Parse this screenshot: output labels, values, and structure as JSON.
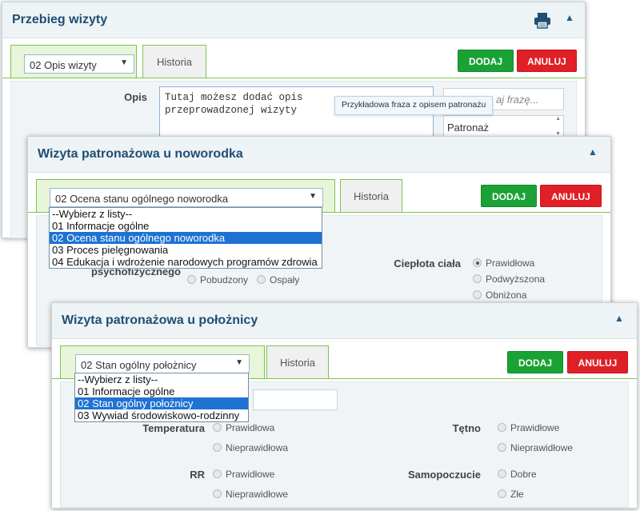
{
  "panel1": {
    "title": "Przebieg wizyty",
    "select_value": "02 Opis wizyty",
    "tab_history": "Historia",
    "btn_add": "DODAJ",
    "btn_cancel": "ANULUJ",
    "opis_label": "Opis",
    "textarea_value": "Tutaj możesz dodać opis\nprzeprowadzonej wizyty",
    "search_placeholder": "Wpisz frazę...",
    "search_visible": "aj frazę...",
    "tooltip": "Przykładowa fraza z opisem patronażu",
    "phrase_item": "Patronaż"
  },
  "panel2": {
    "title": "Wizyta patronażowa u noworodka",
    "select_value": "02 Ocena stanu ogólnego noworodka",
    "tab_history": "Historia",
    "btn_add": "DODAJ",
    "btn_cancel": "ANULUJ",
    "dropdown": [
      "--Wybierz z listy--",
      "01 Informacje ogólne",
      "02 Ocena stanu ogólnego noworodka",
      "03 Proces pielęgnowania",
      "04 Edukacja i wdrożenie narodowych programów zdrowia"
    ],
    "dropdown_selected_index": 2,
    "partial_label": "psychofizycznego",
    "radios_left": [
      "Pobudzony",
      "Ospały"
    ],
    "temp_label": "Ciepłota ciała",
    "temp_options": [
      "Prawidłowa",
      "Podwyższona",
      "Obniżona"
    ],
    "temp_checked_index": 0
  },
  "panel3": {
    "title": "Wizyta patronażowa u położnicy",
    "select_value": "02 Stan ogólny położnicy",
    "tab_history": "Historia",
    "btn_add": "DODAJ",
    "btn_cancel": "ANULUJ",
    "dropdown": [
      "--Wybierz z listy--",
      "01 Informacje ogólne",
      "02 Stan ogólny położnicy",
      "03 Wywiad środowiskowo-rodzinny"
    ],
    "dropdown_selected_index": 2,
    "temperatura_label": "Temperatura",
    "temperatura_options": [
      "Prawidłowa",
      "Nieprawidłowa"
    ],
    "tetno_label": "Tętno",
    "tetno_options": [
      "Prawidłowe",
      "Nieprawidłowe"
    ],
    "rr_label": "RR",
    "rr_options": [
      "Prawidłowe",
      "Nieprawidłowe"
    ],
    "samopoczucie_label": "Samopoczucie",
    "samopoczucie_options": [
      "Dobre",
      "Złe"
    ]
  },
  "icons": {
    "print": "printer-icon",
    "collapse": "chevron-up-icon",
    "dropdown": "caret-down-icon"
  },
  "colors": {
    "green": "#1aa235",
    "red": "#e01f26",
    "title": "#1f4e74",
    "tab_border": "#7cc24e",
    "highlight": "#1e73d2"
  }
}
